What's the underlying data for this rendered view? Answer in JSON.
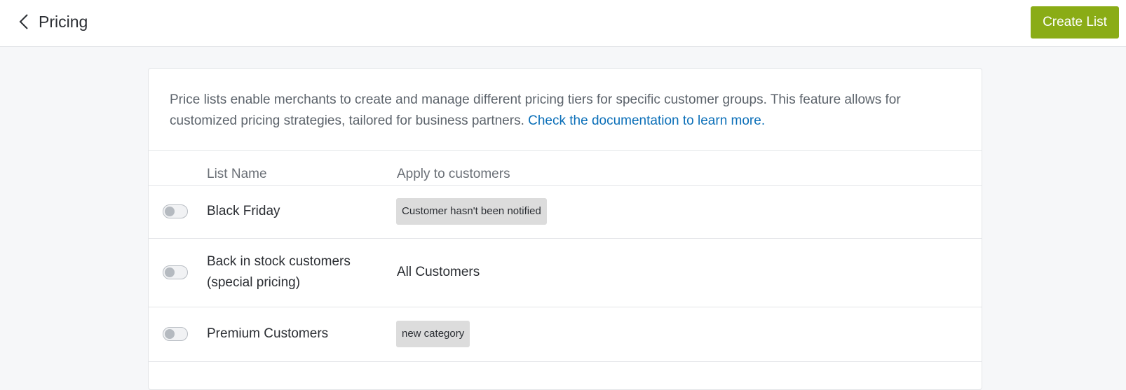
{
  "header": {
    "title": "Pricing",
    "create_button": "Create List"
  },
  "intro": {
    "text": "Price lists enable merchants to create and manage different pricing tiers for specific customer groups. This feature allows for customized pricing strategies, tailored for business partners. ",
    "link": "Check the documentation to learn more."
  },
  "table": {
    "columns": [
      "List Name",
      "Apply to customers"
    ],
    "rows": [
      {
        "name": "Black Friday",
        "apply": "Customer hasn't been notified",
        "apply_style": "badge",
        "enabled": false
      },
      {
        "name": "Back in stock customers (special pricing)",
        "apply": "All Customers",
        "apply_style": "plain",
        "enabled": false
      },
      {
        "name": "Premium Customers",
        "apply": "new category",
        "apply_style": "badge",
        "enabled": false
      }
    ]
  }
}
